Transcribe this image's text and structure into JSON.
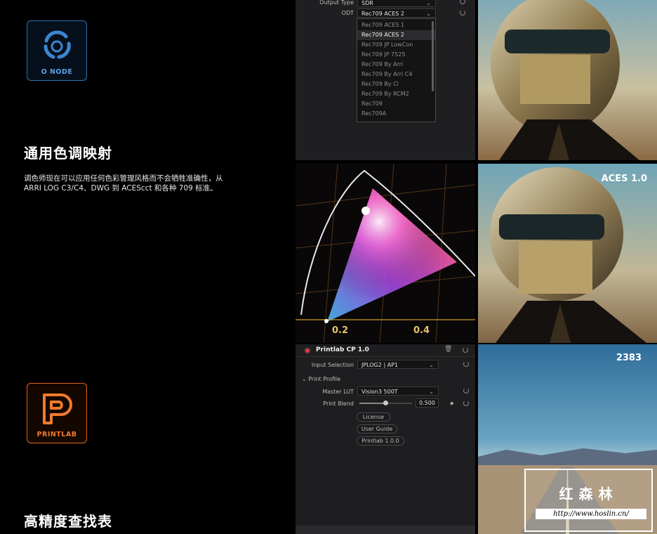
{
  "left": {
    "onode_label": "O NODE",
    "tone_title": "通用色调映射",
    "tone_desc": "调色师现在可以应用任何色彩管理风格而不会牺牲准确性，从 ARRI LOG C3/C4、DWG 到 ACEScct 和各种 709 标准。",
    "printlab_label": "PRINTLAB",
    "lut_title": "高精度查找表"
  },
  "odt_panel": {
    "output_type_label": "Output Type",
    "output_type_value": "SDR",
    "odt_label": "ODT",
    "odt_value": "Rec709 ACES 2",
    "options": [
      "Rec709 ACES 1",
      "Rec709 ACES 2",
      "Rec709 JP LowCon",
      "Rec709 JP 7525",
      "Rec709 By Arri",
      "Rec709 By Arri C4",
      "Rec709 By Cl",
      "Rec709 By RCM2",
      "Rec709",
      "Rec709A"
    ],
    "selected_index": 1
  },
  "chart_panel": {
    "tick_02": "0.2",
    "tick_04": "0.4"
  },
  "printlab_panel": {
    "title": "Printlab CP 1.0",
    "input_selection_label": "Input Selection",
    "input_selection_value": "JPLOG2 | AP1",
    "print_profile_label": "Print Profile",
    "master_lut_label": "Master LUT",
    "master_lut_value": "Vision3 500T",
    "print_blend_label": "Print Blend",
    "print_blend_value": "0.500",
    "print_blend_level": 0.5,
    "buttons": [
      "License",
      "User Guide",
      "Printlab 1.0.0"
    ]
  },
  "photos": {
    "mid_label": "ACES 1.0",
    "desert_label": "2383"
  },
  "watermark": {
    "title": "红森林",
    "url": "http://www.hoslin.cn/"
  },
  "colors": {
    "onode_blue": "#2f6fb0",
    "printlab_orange": "#e2621b",
    "record_red": "#e03a3a"
  }
}
